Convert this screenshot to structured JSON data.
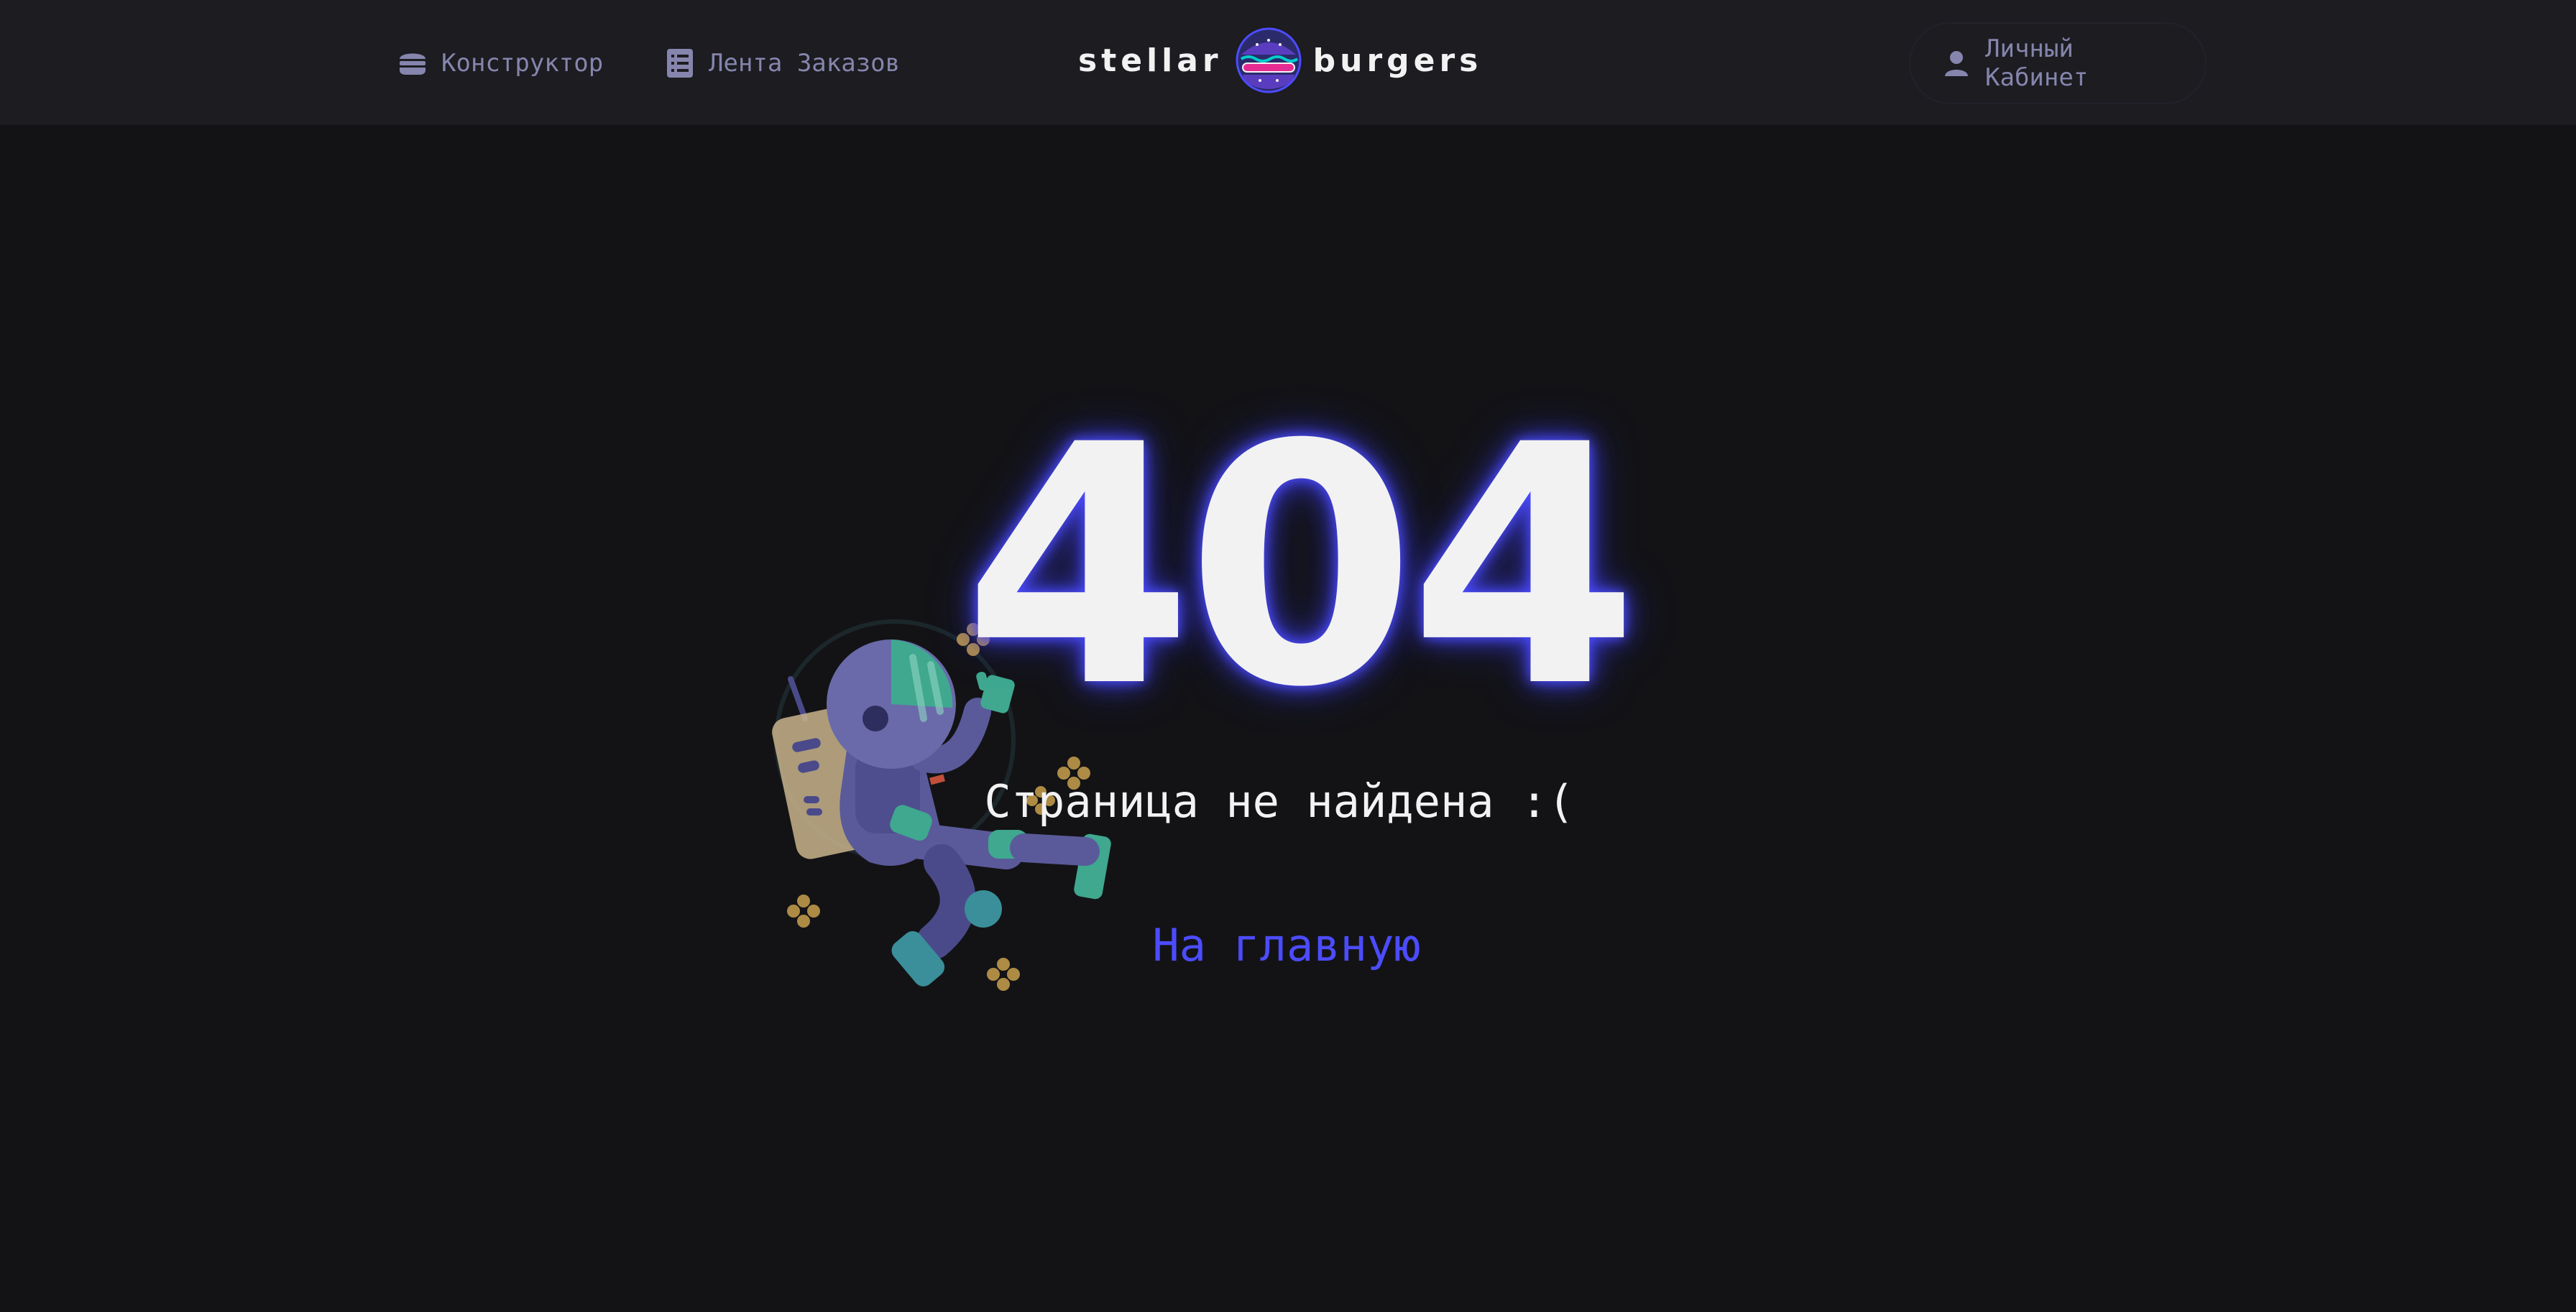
{
  "header": {
    "nav": {
      "constructor_label": "Конструктор",
      "feed_label": "Лента Заказов",
      "profile_label": "Личный Кабинет"
    },
    "logo": {
      "left_text": "stellar",
      "right_text": "burgers"
    }
  },
  "main": {
    "error_code": "404",
    "message": "Страница не найдена :(",
    "home_link_label": "На главную"
  },
  "icons": {
    "constructor": "burger-icon",
    "feed": "list-icon",
    "profile": "profile-icon",
    "illustration": "astronaut-illustration"
  },
  "colors": {
    "background": "#131316",
    "header_background": "#1c1c21",
    "text_primary": "#f2f2f3",
    "text_inactive": "#8585ad",
    "accent": "#4c4cff"
  }
}
